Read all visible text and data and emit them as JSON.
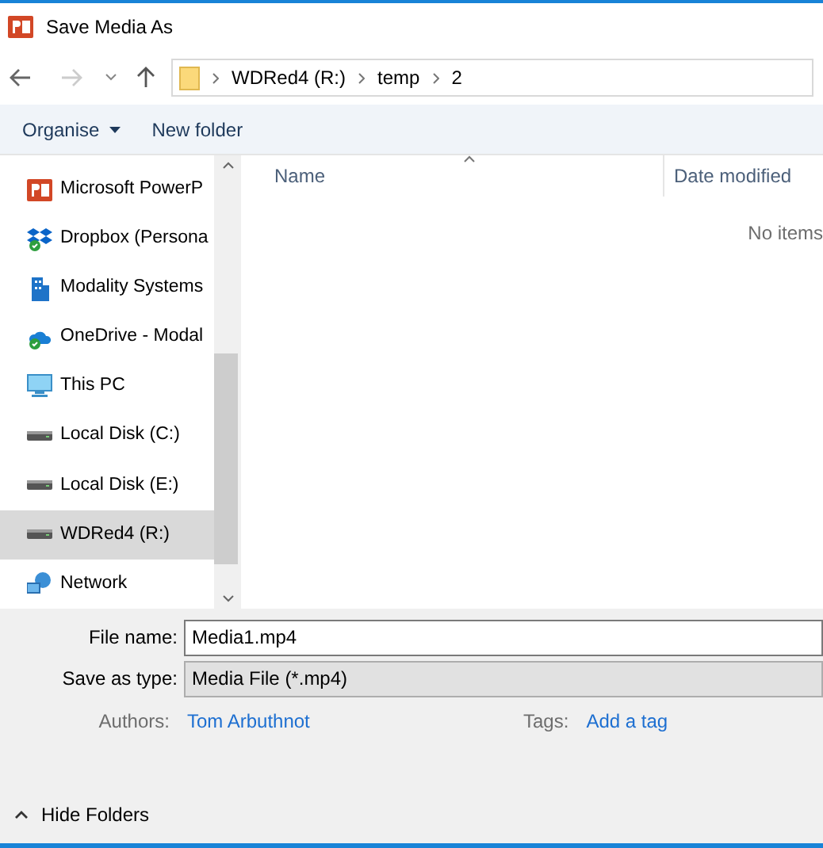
{
  "window": {
    "title": "Save Media As"
  },
  "address": {
    "path": [
      "WDRed4 (R:)",
      "temp",
      "2"
    ]
  },
  "toolbar": {
    "organise": "Organise",
    "new_folder": "New folder"
  },
  "sidebar": {
    "items": [
      {
        "label": "Microsoft PowerP",
        "kind": "powerpoint",
        "selected": false
      },
      {
        "label": "Dropbox (Persona",
        "kind": "dropbox",
        "selected": false
      },
      {
        "label": "Modality Systems",
        "kind": "building",
        "selected": false
      },
      {
        "label": "OneDrive - Modal",
        "kind": "onedrive",
        "selected": false
      },
      {
        "label": "This PC",
        "kind": "pc",
        "selected": false
      },
      {
        "label": "Local Disk (C:)",
        "kind": "disk",
        "selected": false
      },
      {
        "label": "Local Disk (E:)",
        "kind": "disk",
        "selected": false
      },
      {
        "label": "WDRed4 (R:)",
        "kind": "disk",
        "selected": true
      },
      {
        "label": "Network",
        "kind": "network",
        "selected": false
      }
    ]
  },
  "file_list": {
    "columns": [
      "Name",
      "Date modified"
    ],
    "empty_text": "No items"
  },
  "form": {
    "file_name_label": "File name:",
    "file_name": "Media1.mp4",
    "type_label": "Save as type:",
    "type": "Media File (*.mp4)",
    "authors_label": "Authors:",
    "authors": "Tom Arbuthnot",
    "tags_label": "Tags:",
    "tags": "Add a tag"
  },
  "footer": {
    "hide_folders": "Hide Folders"
  }
}
